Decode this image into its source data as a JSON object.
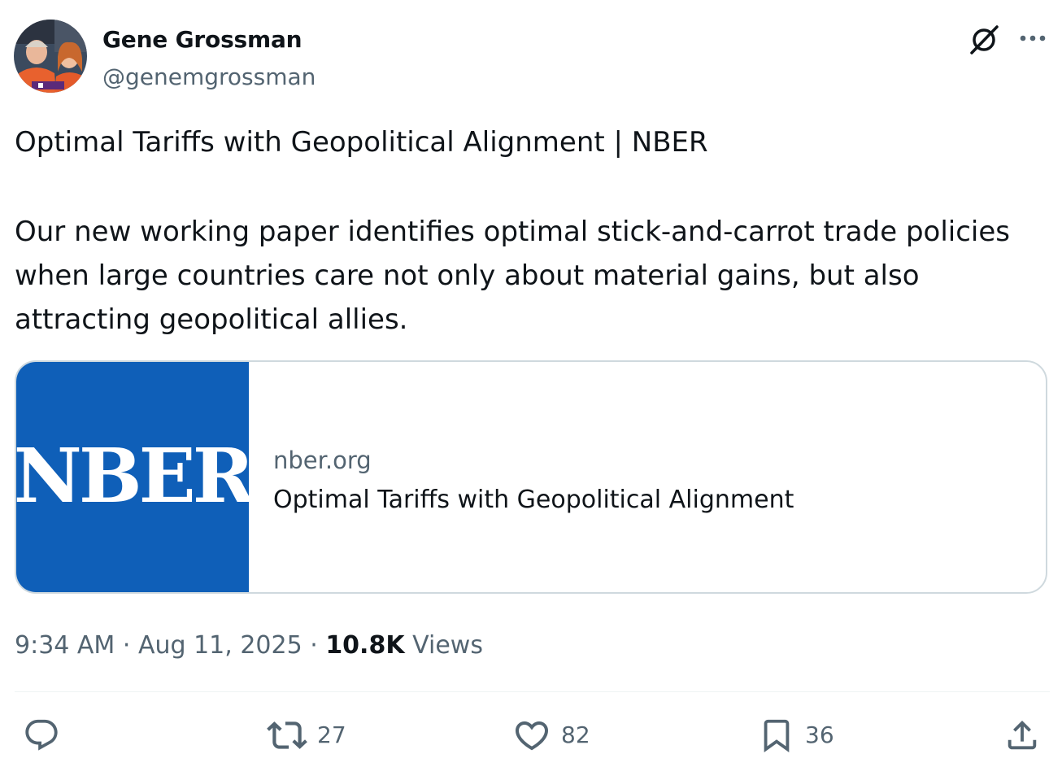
{
  "author": {
    "name": "Gene Grossman",
    "handle": "@genemgrossman"
  },
  "icons": {
    "grok": "grok-icon",
    "more": "more-icon",
    "reply": "reply-icon",
    "retweet": "retweet-icon",
    "like": "heart-icon",
    "bookmark": "bookmark-icon",
    "share": "share-icon"
  },
  "tweet": {
    "title": "Optimal Tariffs with Geopolitical Alignment | NBER",
    "body": "Our new working paper identifies optimal stick-and-carrot trade policies when large countries care not only about material gains, but also attracting geopolitical allies."
  },
  "link_card": {
    "logo_text": "NBER",
    "domain": "nber.org",
    "title": "Optimal Tariffs with Geopolitical Alignment",
    "logo_bg_color": "#0f5fb8"
  },
  "meta": {
    "time": "9:34 AM",
    "sep1": "·",
    "date": "Aug 11, 2025",
    "sep2": "·",
    "views_count": "10.8K",
    "views_label": "Views"
  },
  "actions": {
    "reply_count": "",
    "retweet_count": "27",
    "like_count": "82",
    "bookmark_count": "36"
  },
  "colors": {
    "text_primary": "#0f1419",
    "text_secondary": "#536471",
    "border": "#cfd9de"
  }
}
